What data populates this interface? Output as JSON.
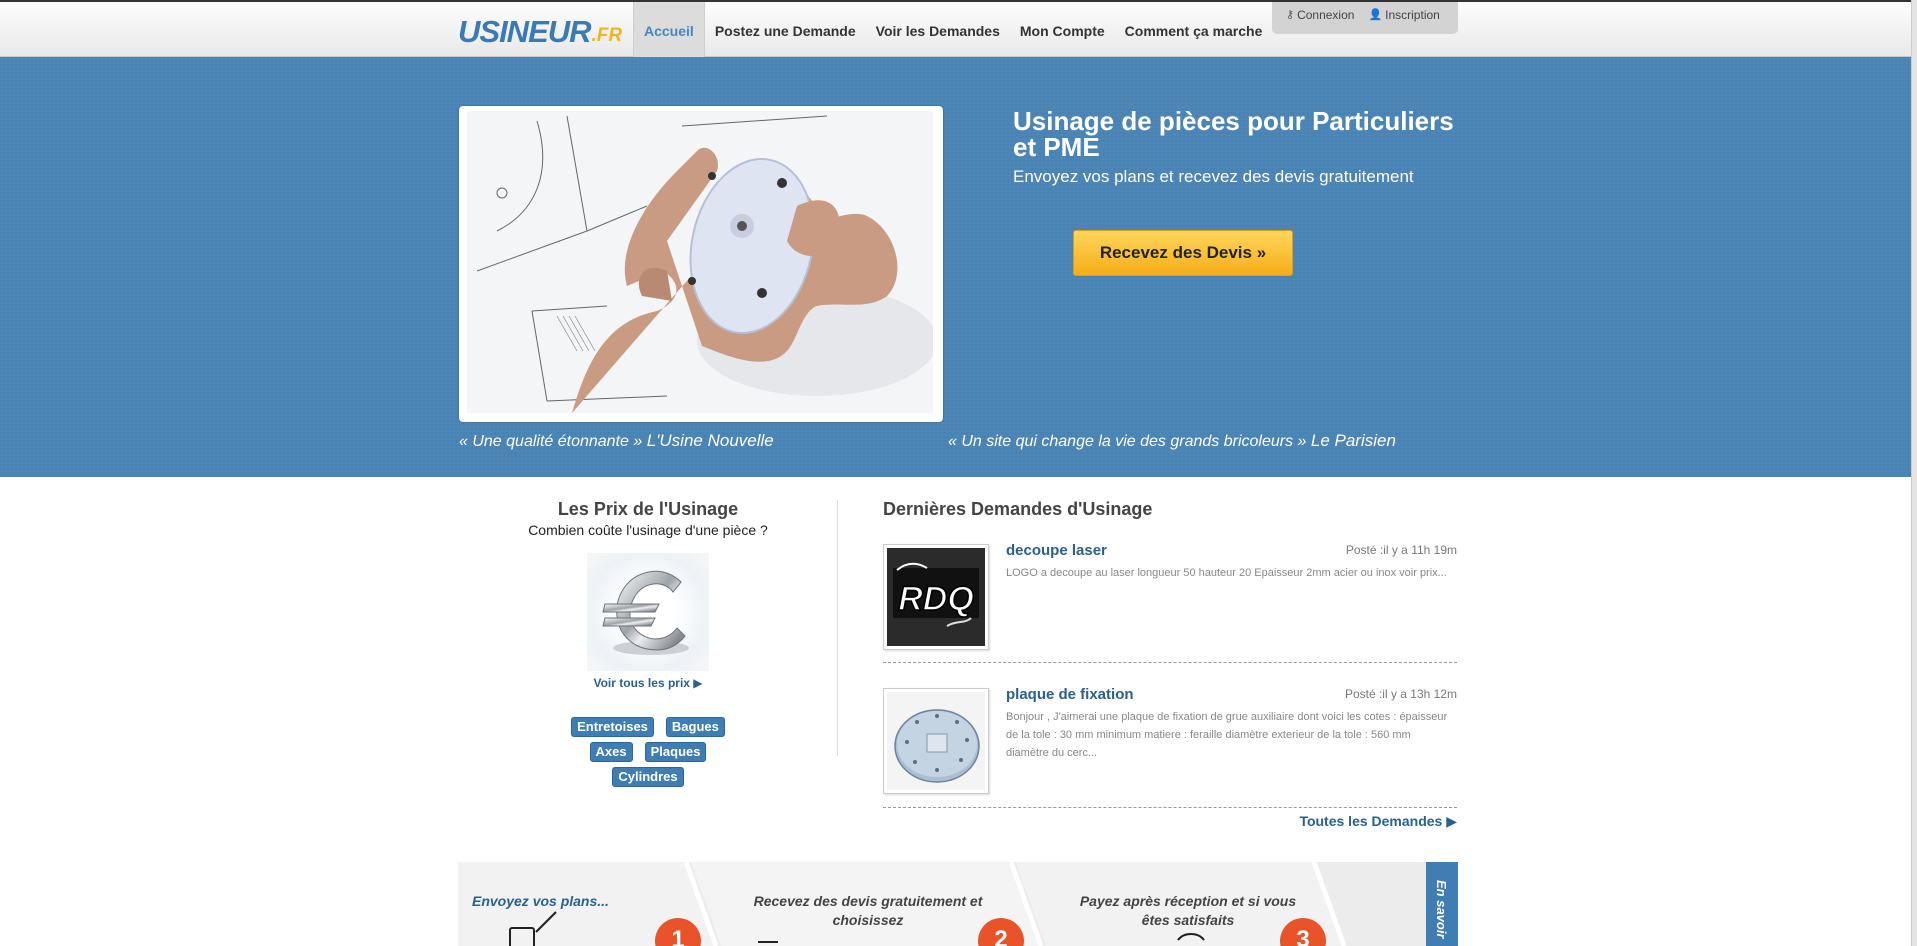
{
  "nav": {
    "logo_main": "USINEUR",
    "logo_tld": ".FR",
    "items": [
      {
        "label": "Accueil",
        "active": true
      },
      {
        "label": "Postez une Demande",
        "active": false
      },
      {
        "label": "Voir les Demandes",
        "active": false
      },
      {
        "label": "Mon Compte",
        "active": false
      },
      {
        "label": "Comment ça marche",
        "active": false
      }
    ],
    "login": "Connexion",
    "signup": "Inscription"
  },
  "hero": {
    "title": "Usinage de pièces pour Particuliers et PME",
    "subtitle": "Envoyez vos plans et recevez des devis gratuitement",
    "cta": "Recevez des Devis  »",
    "quotes": [
      {
        "text": "« Une qualité étonnante » ",
        "source": "L'Usine Nouvelle"
      },
      {
        "text": "« Un site qui change la vie des grands bricoleurs » ",
        "source": "Le Parisien"
      }
    ]
  },
  "prices": {
    "title": "Les Prix de l'Usinage",
    "subtitle": "Combien coûte l'usinage d'une pièce ?",
    "link": "Voir tous les prix ▶",
    "tags": [
      "Entretoises",
      "Bagues",
      "Axes",
      "Plaques",
      "Cylindres"
    ]
  },
  "requests": {
    "title": "Dernières Demandes d'Usinage",
    "items": [
      {
        "name": "decoupe laser",
        "posted": "Posté :il y a 11h 19m",
        "desc": "LOGO a decoupe au laser longueur 50 hauteur 20 Epaisseur 2mm acier ou inox voir prix..."
      },
      {
        "name": "plaque de fixation",
        "posted": "Posté :il y a 13h 12m",
        "desc": "Bonjour , J'aimerai une plaque de fixation de grue auxiliaire dont voici les cotes : épaisseur de la tole : 30 mm minimum matiere : feraille diamètre exterieur de la tole : 560 mm diamètre du cerc..."
      }
    ],
    "all_link": "Toutes les Demandes ▶"
  },
  "steps": {
    "items": [
      {
        "text": "Envoyez vos plans...",
        "num": "1"
      },
      {
        "text": "Recevez des devis gratuitement et choisissez",
        "num": "2"
      },
      {
        "text": "Payez après réception et si vous êtes satisfaits",
        "num": "3"
      }
    ],
    "more": "En savoir"
  },
  "thumb1_text": "RDQ",
  "colors": {
    "brand_blue": "#3b7bb5",
    "hero_bg": "#4a84b5",
    "cta_yellow": "#f6ad17",
    "step_orange": "#e8532a"
  }
}
